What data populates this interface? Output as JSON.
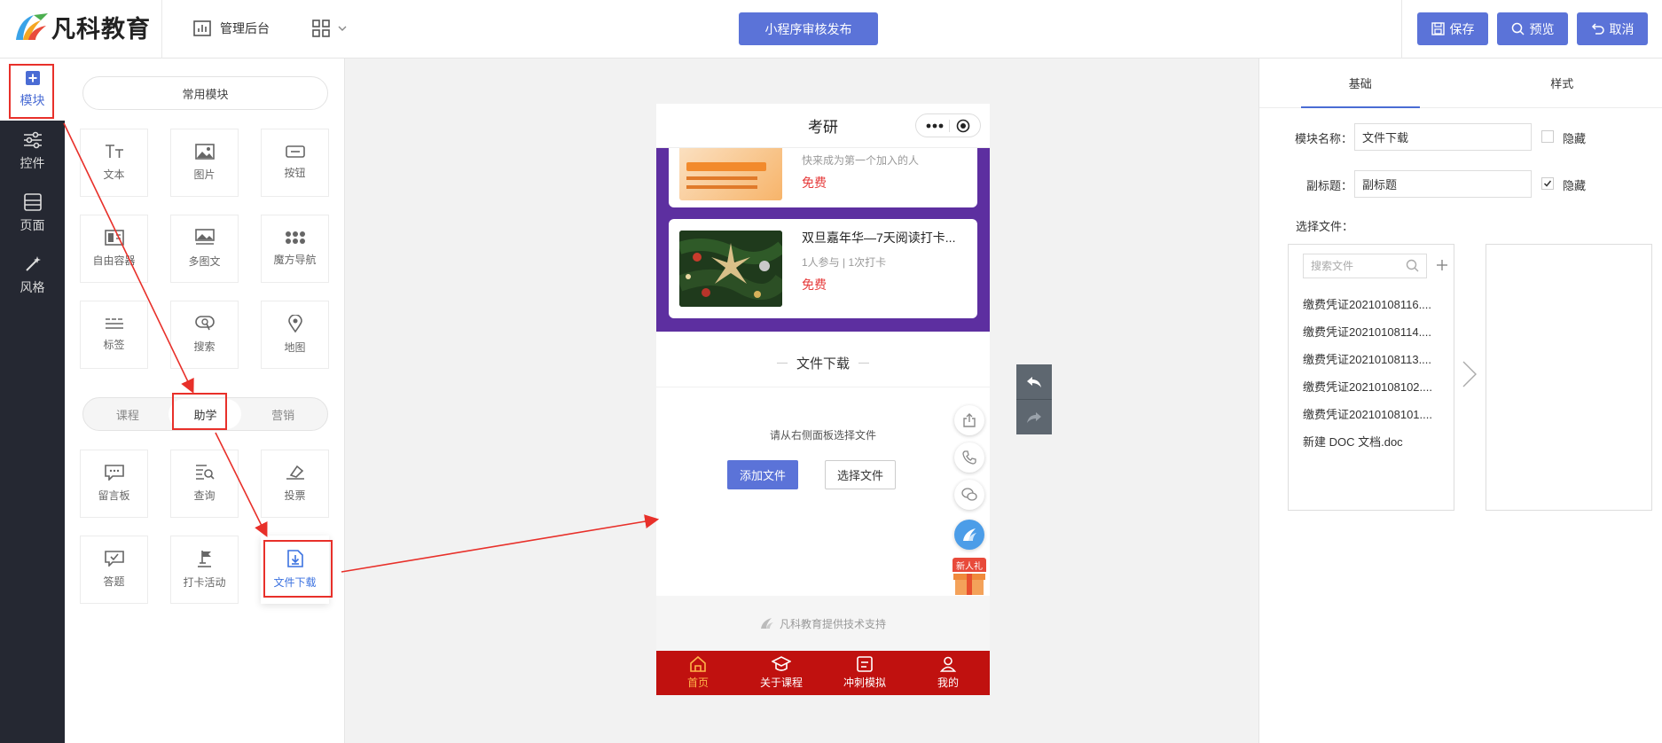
{
  "header": {
    "brand": "凡科教育",
    "admin_label": "管理后台",
    "publish_label": "小程序审核发布",
    "save_label": "保存",
    "preview_label": "预览",
    "cancel_label": "取消",
    "accent_color": "#5b73d8"
  },
  "leftnav": {
    "items": [
      {
        "label": "模块",
        "icon": "plus-square-icon"
      },
      {
        "label": "控件",
        "icon": "sliders-icon"
      },
      {
        "label": "页面",
        "icon": "layout-icon"
      },
      {
        "label": "风格",
        "icon": "magic-wand-icon"
      }
    ]
  },
  "modules": {
    "common_label": "常用模块",
    "common": [
      {
        "label": "文本",
        "icon": "text-icon"
      },
      {
        "label": "图片",
        "icon": "image-icon"
      },
      {
        "label": "按钮",
        "icon": "button-icon"
      },
      {
        "label": "自由容器",
        "icon": "container-icon"
      },
      {
        "label": "多图文",
        "icon": "multi-image-text-icon"
      },
      {
        "label": "魔方导航",
        "icon": "grid-dots-icon"
      },
      {
        "label": "标签",
        "icon": "tag-lines-icon"
      },
      {
        "label": "搜索",
        "icon": "search-box-icon"
      },
      {
        "label": "地图",
        "icon": "map-pin-icon"
      }
    ],
    "tabs": [
      "课程",
      "助学",
      "营销"
    ],
    "active_tab": "助学",
    "study": [
      {
        "label": "留言板",
        "icon": "message-board-icon"
      },
      {
        "label": "查询",
        "icon": "query-icon"
      },
      {
        "label": "投票",
        "icon": "vote-icon"
      },
      {
        "label": "答题",
        "icon": "quiz-icon"
      },
      {
        "label": "打卡活动",
        "icon": "checkin-flag-icon"
      },
      {
        "label": "文件下载",
        "icon": "file-download-icon"
      }
    ]
  },
  "phone": {
    "title": "考研",
    "card1": {
      "meta": "快来成为第一个加入的人",
      "price": "免费"
    },
    "card2": {
      "title": "双旦嘉年华—7天阅读打卡...",
      "meta": "1人参与 | 1次打卡",
      "price": "免费"
    },
    "file_section_title": "文件下载",
    "hint": "请从右侧面板选择文件",
    "add_file": "添加文件",
    "choose_file": "选择文件",
    "gift_label": "新人礼",
    "support": "凡科教育提供技术支持",
    "tabbar": [
      {
        "label": "首页",
        "icon": "home-icon"
      },
      {
        "label": "关于课程",
        "icon": "graduation-cap-icon"
      },
      {
        "label": "冲刺模拟",
        "icon": "exam-icon"
      },
      {
        "label": "我的",
        "icon": "user-icon"
      }
    ],
    "tabbar_color": "#c0110f",
    "purple_color": "#5d2fa0"
  },
  "props": {
    "tabs": [
      "基础",
      "样式"
    ],
    "name_label": "模块名称：",
    "name_value": "文件下载",
    "subtitle_label": "副标题：",
    "subtitle_value": "副标题",
    "hide_label": "隐藏",
    "subtitle_hidden": true,
    "name_hidden": false,
    "select_file_label": "选择文件：",
    "search_placeholder": "搜索文件",
    "files": [
      "缴费凭证20210108116....",
      "缴费凭证20210108114....",
      "缴费凭证20210108113....",
      "缴费凭证20210108102....",
      "缴费凭证20210108101....",
      "新建 DOC 文档.doc"
    ]
  }
}
